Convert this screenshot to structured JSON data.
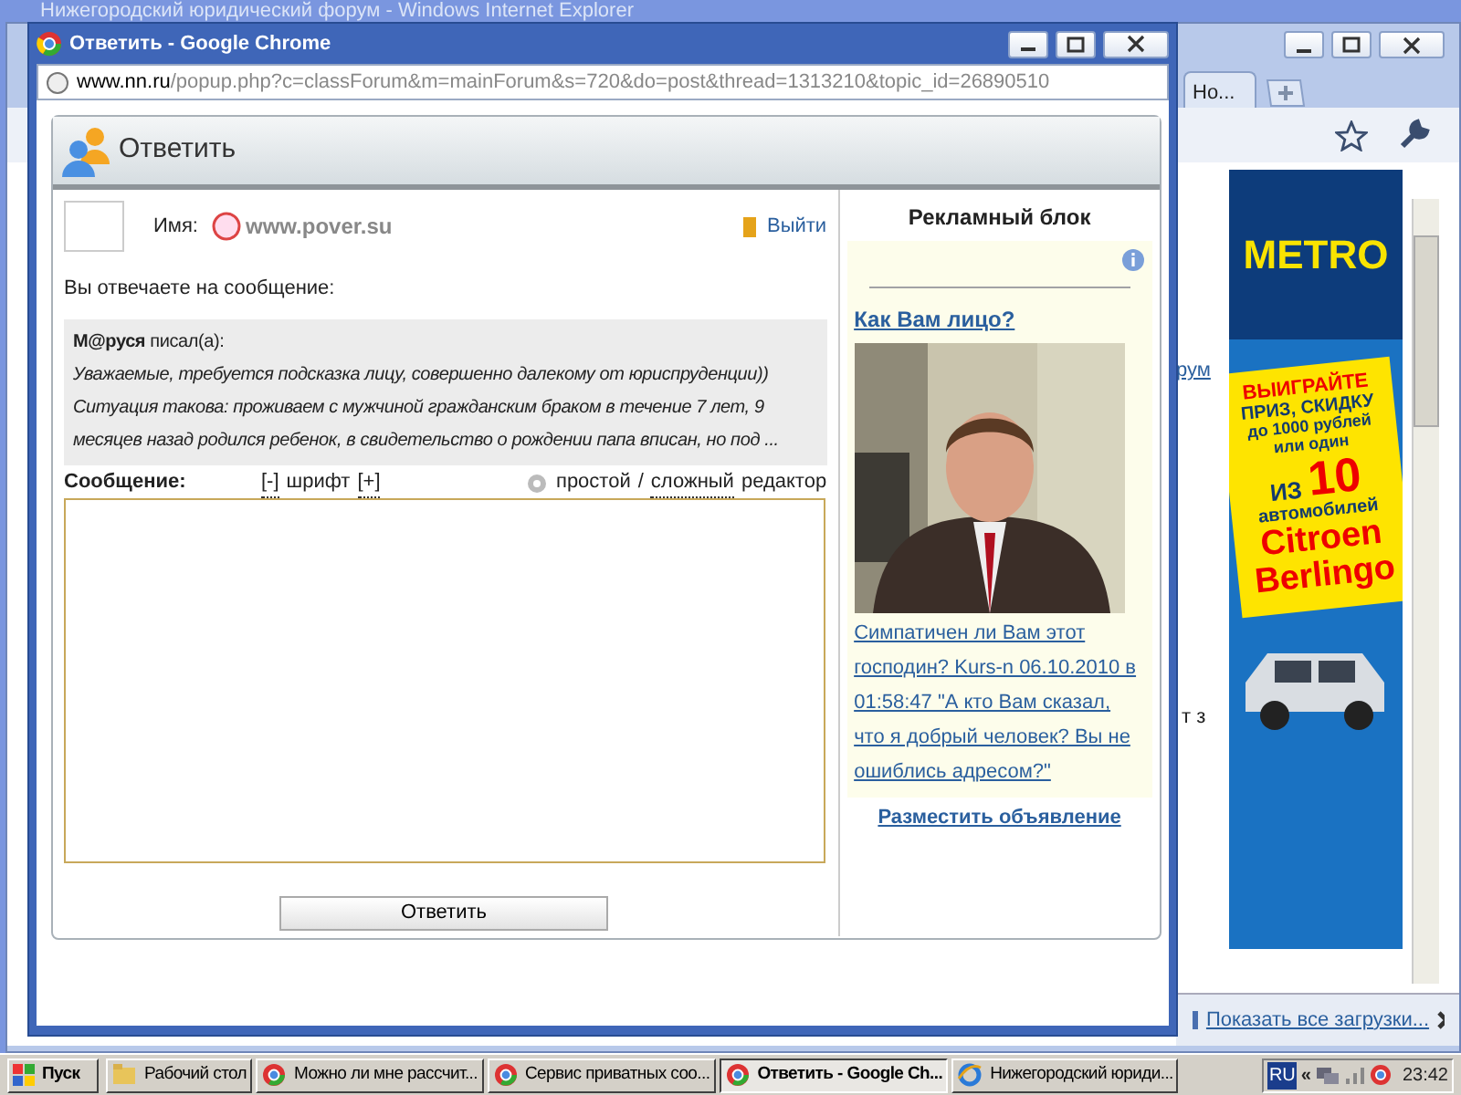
{
  "background_window": {
    "title": "Нижегородский юридический форум - Windows Internet Explorer"
  },
  "background_browser": {
    "tab": "Но...",
    "page_fragments": [
      {
        "text": "рум",
        "kind": "link"
      },
      {
        "text": "т з",
        "kind": "text"
      }
    ],
    "banner": {
      "brand": "METRO",
      "lines": [
        "ВЫИГРАЙТЕ",
        "ПРИЗ, СКИДКУ",
        "до 1000 рублей",
        "или один"
      ],
      "from": "ИЗ",
      "number": "10",
      "cars": "автомобилей",
      "model": [
        "Citroen",
        "Berlingo"
      ]
    },
    "downloads_link": "Показать все загрузки..."
  },
  "popup": {
    "title": "Ответить - Google Chrome",
    "url_host": "www.nn.ru",
    "url_path": "/popup.php?c=classForum&m=mainForum&s=720&do=post&thread=1313210&topic_id=26890510",
    "page": {
      "heading": "Ответить",
      "name_label": "Имя:",
      "user": "www.pover.su",
      "logout": "Выйти",
      "reply_to_label": "Вы отвечаете на сообщение:",
      "quote": {
        "author": "**М@руся** писал(а):",
        "text": "Уважаемые, требуется подсказка лицу, совершенно далекому от юриспруденции)) Ситуация такова: проживаем с мужчиной гражданским браком в течение 7 лет, 9 месяцев назад родился ребенок, в свидетельство о рождении папа вписан, но под ..."
      },
      "message_label": "Сообщение:",
      "font_controls": [
        "[-]",
        "шрифт",
        "[+]"
      ],
      "editor_modes": [
        {
          "label": "простой",
          "selected": true
        },
        {
          "label": "сложный",
          "selected": false
        }
      ],
      "editor_separator": "/",
      "editor_suffix": "редактор",
      "submit": "Ответить"
    },
    "ad_block": {
      "title": "Рекламный блок",
      "headline": "Как Вам лицо?",
      "text": "Симпатичен ли Вам этот господин? Kurs-n 06.10.2010 в 01:58:47 \"А кто Вам сказал, что я добрый человек? Вы не ошиблись адресом?\"",
      "post_ad": "Разместить объявление"
    }
  },
  "taskbar": {
    "start": "Пуск",
    "items": [
      {
        "label": "Рабочий стол",
        "kind": "folder",
        "selected": false
      },
      {
        "label": "Можно ли мне рассчит...",
        "kind": "chrome",
        "selected": false
      },
      {
        "label": "Сервис приватных соо...",
        "kind": "chrome",
        "selected": false
      },
      {
        "label": "Ответить - Google Ch...",
        "kind": "chrome",
        "selected": true
      },
      {
        "label": "Нижегородский юриди...",
        "kind": "ie",
        "selected": false
      }
    ],
    "language": "RU",
    "expand": "«",
    "clock": "23:42"
  }
}
